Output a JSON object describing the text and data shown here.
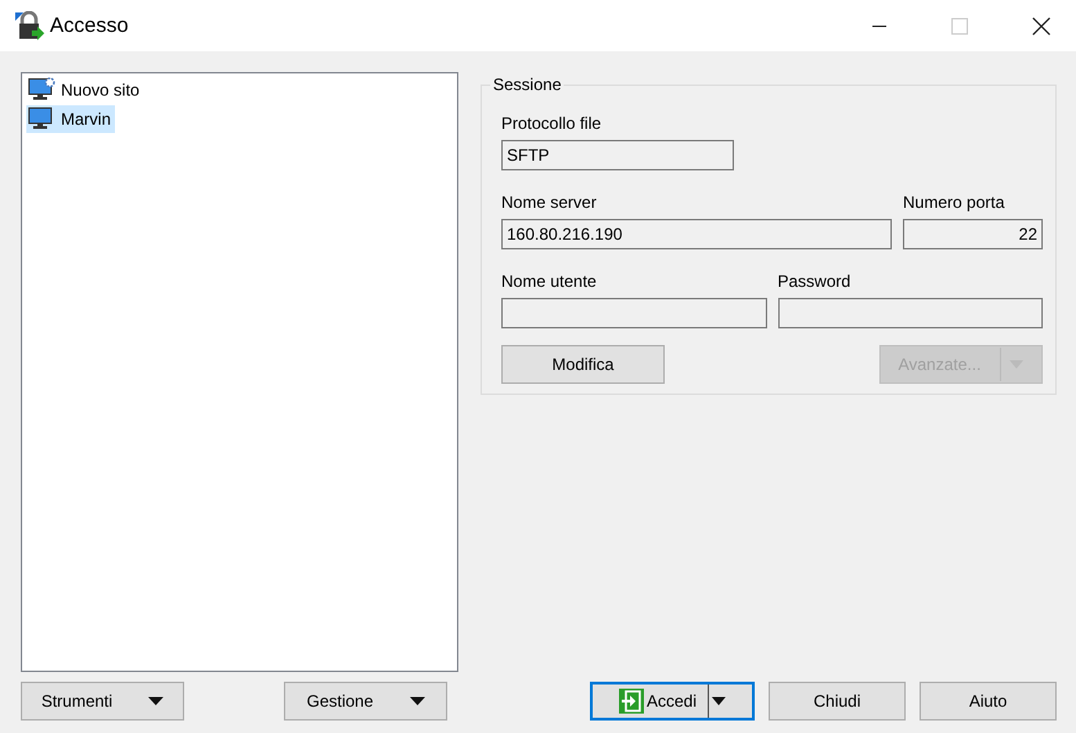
{
  "window": {
    "title": "Accesso"
  },
  "sites": [
    {
      "name": "Nuovo sito",
      "kind": "new",
      "selected": false
    },
    {
      "name": "Marvin",
      "kind": "site",
      "selected": true
    }
  ],
  "session": {
    "title": "Sessione",
    "protocol": {
      "label": "Protocollo file",
      "value": "SFTP"
    },
    "server": {
      "label": "Nome server",
      "value": "160.80.216.190"
    },
    "port": {
      "label": "Numero porta",
      "value": "22"
    },
    "user": {
      "label": "Nome utente"
    },
    "password": {
      "label": "Password"
    },
    "buttons": [
      {
        "label": "Modifica",
        "disabled": false,
        "dropdown": false
      },
      {
        "label": "Avanzate...",
        "disabled": true,
        "dropdown": true
      }
    ]
  },
  "left_buttons": [
    {
      "label": "Strumenti",
      "dropdown": true
    },
    {
      "label": "Gestione",
      "dropdown": true
    }
  ],
  "right_buttons": [
    {
      "label": "Accedi",
      "default": true,
      "dropdown": true
    },
    {
      "label": "Chiudi",
      "default": false,
      "dropdown": false
    },
    {
      "label": "Aiuto",
      "default": false,
      "dropdown": false
    }
  ]
}
